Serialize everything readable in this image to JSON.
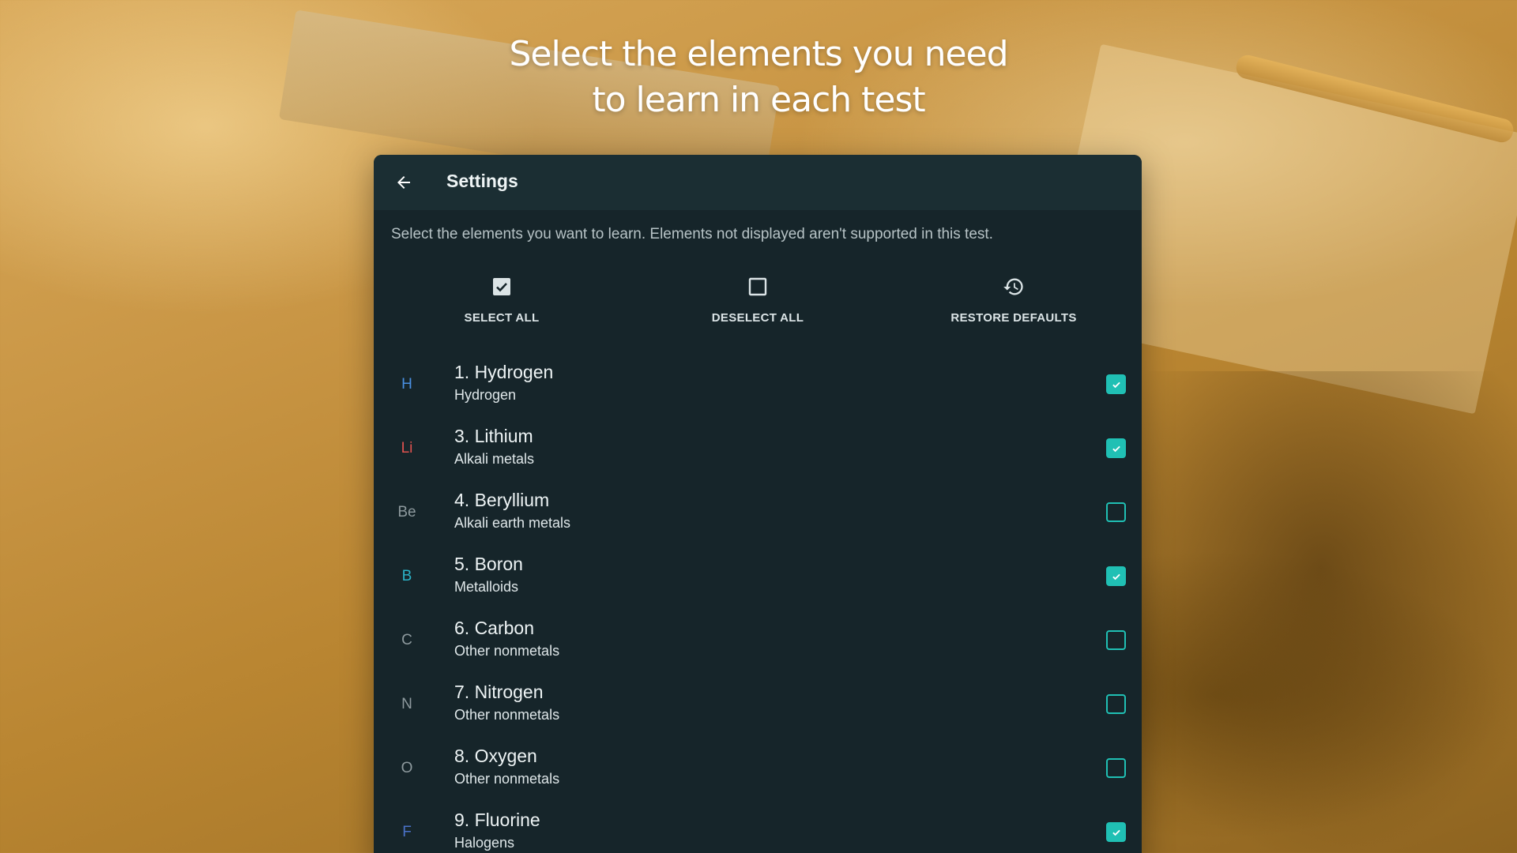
{
  "headline": {
    "line1": "Select the elements you need",
    "line2": "to learn in each test"
  },
  "appbar": {
    "title": "Settings",
    "back_icon": "arrow-left-icon"
  },
  "description": "Select the elements you want to learn. Elements not displayed aren't supported in this test.",
  "actions": [
    {
      "label": "SELECT ALL",
      "icon": "checkbox-checked-icon"
    },
    {
      "label": "DESELECT ALL",
      "icon": "checkbox-empty-icon"
    },
    {
      "label": "RESTORE DEFAULTS",
      "icon": "history-icon"
    }
  ],
  "colors": {
    "accent": "#20c0b4",
    "panel_bg": "#16252a",
    "appbar_bg": "#1b2e33"
  },
  "elements": [
    {
      "symbol": "H",
      "name": "1. Hydrogen",
      "category": "Hydrogen",
      "checked": true,
      "symbol_color": "#4a90e2"
    },
    {
      "symbol": "Li",
      "name": "3. Lithium",
      "category": "Alkali metals",
      "checked": true,
      "symbol_color": "#e0524f"
    },
    {
      "symbol": "Be",
      "name": "4. Beryllium",
      "category": "Alkali earth metals",
      "checked": false,
      "symbol_color": "#8e9a9e"
    },
    {
      "symbol": "B",
      "name": "5. Boron",
      "category": "Metalloids",
      "checked": true,
      "symbol_color": "#2bb3c8"
    },
    {
      "symbol": "C",
      "name": "6. Carbon",
      "category": "Other nonmetals",
      "checked": false,
      "symbol_color": "#8e9a9e"
    },
    {
      "symbol": "N",
      "name": "7. Nitrogen",
      "category": "Other nonmetals",
      "checked": false,
      "symbol_color": "#8e9a9e"
    },
    {
      "symbol": "O",
      "name": "8. Oxygen",
      "category": "Other nonmetals",
      "checked": false,
      "symbol_color": "#8e9a9e"
    },
    {
      "symbol": "F",
      "name": "9. Fluorine",
      "category": "Halogens",
      "checked": true,
      "symbol_color": "#4a72c8"
    }
  ]
}
